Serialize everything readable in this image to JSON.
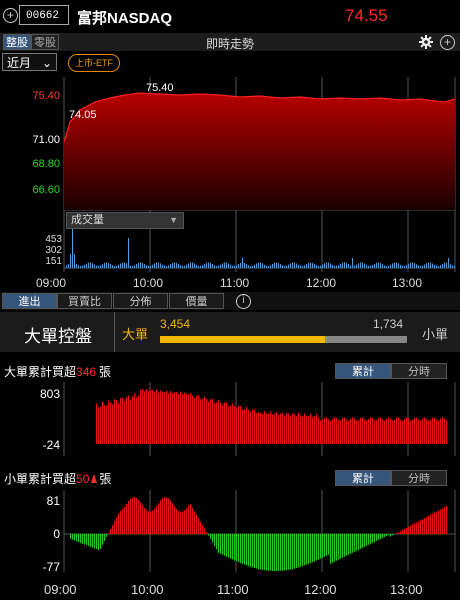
{
  "header": {
    "code": "00662",
    "name": "富邦NASDAQ",
    "price": "74.55"
  },
  "toolbar": {
    "seg_full": "整股",
    "seg_odd": "零股",
    "title": "即時走勢"
  },
  "period": {
    "selected": "近月"
  },
  "badge": "上市-ETF",
  "price_chart": {
    "y_ticks": [
      {
        "label": "75.40",
        "color": "#ff3b3b"
      },
      {
        "label": "71.00",
        "color": "#ffffff"
      },
      {
        "label": "68.80",
        "color": "#22dd22"
      },
      {
        "label": "66.60",
        "color": "#22dd22"
      }
    ],
    "high_label": "75.40",
    "low_label": "74.05",
    "volume_dropdown": "成交量",
    "volume_ticks": [
      "453",
      "302",
      "151"
    ]
  },
  "time_axis": [
    "09:00",
    "10:00",
    "11:00",
    "12:00",
    "13:00"
  ],
  "tabs": [
    "進出",
    "買賣比",
    "分佈",
    "價量"
  ],
  "order_flow": {
    "title": "大單控盤",
    "big_label": "大單",
    "small_label": "小單",
    "big_value": "3,454",
    "small_value": "1,734",
    "big_ratio": 0.666
  },
  "chart_data": [
    {
      "type": "bar",
      "title_prefix": "大單累計買超",
      "title_value": "346",
      "title_suffix": "張",
      "y_ticks": [
        "803",
        "0",
        "-24"
      ],
      "ylim": [
        -24,
        803
      ],
      "tabs": [
        "累計",
        "分時"
      ],
      "series_summary": "cumulative net buy of large orders, rising from ~0 at 09:25 to ~800 at 10:00 then easing to ~346 by 13:30"
    },
    {
      "type": "bar",
      "title_prefix": "小單累計買超",
      "title_value": "50",
      "title_suffix": "張",
      "y_ticks": [
        "81",
        "0",
        "-77"
      ],
      "ylim": [
        -77,
        81
      ],
      "tabs": [
        "累計",
        "分時"
      ],
      "series_summary": "cumulative net buy of small orders, positive ~81 near 10:00, negative ~-77 near 12:00, ending ~50"
    }
  ],
  "colors": {
    "up": "#ff2a2a",
    "down": "#22cc22",
    "accent": "#36557a",
    "bar_fill": "#f5b800"
  },
  "icons": [
    "plus-circle-icon",
    "gear-icon",
    "info-icon",
    "chevron-down-icon"
  ]
}
